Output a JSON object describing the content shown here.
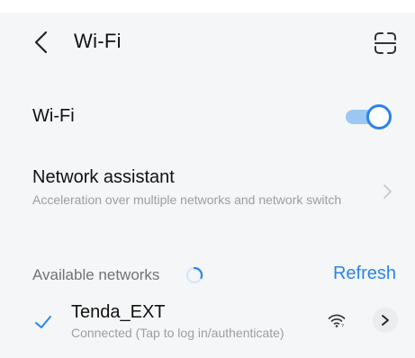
{
  "header": {
    "back_icon": "chevron-left-icon",
    "title": "Wi-Fi",
    "scan_icon": "qr-scan-icon"
  },
  "wifi_toggle": {
    "label": "Wi-Fi",
    "on": true
  },
  "network_assistant": {
    "title": "Network assistant",
    "description": "Acceleration over multiple networks and network switch",
    "chevron_icon": "chevron-right-icon"
  },
  "available_networks": {
    "label": "Available networks",
    "refresh_label": "Refresh",
    "scanning": true
  },
  "networks": [
    {
      "ssid": "Tenda_EXT",
      "status": "Connected (Tap to log in/authenticate)",
      "connected": true,
      "signal_icon": "wifi-signal-icon"
    }
  ],
  "colors": {
    "accent": "#2a84ea",
    "toggle_track": "#9cc6f3",
    "background": "#f5f6f7",
    "secondary_text": "#9a9ea3"
  }
}
